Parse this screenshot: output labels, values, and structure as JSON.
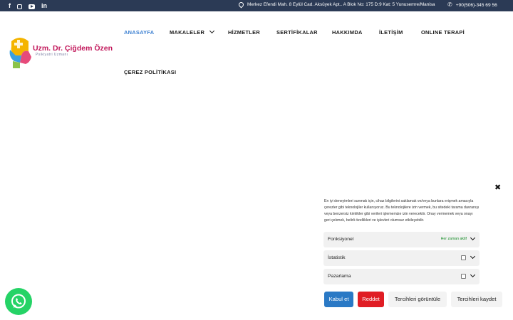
{
  "topbar": {
    "social_icons": [
      "facebook-icon",
      "instagram-icon",
      "youtube-icon",
      "linkedin-icon"
    ],
    "address": "Merkez Efendi Mah. 8 Eylül Cad. Aksüyek Apt.. A Blok No: 175 D:9 Kat: 5 Yunusemre/Manisa",
    "phone": "+90(506)-345 69 56",
    "background": "#2b3a55"
  },
  "logo": {
    "name": "Uzm. Dr. Çiğdem Özen",
    "subtitle": "Psikiyatri Uzmanı"
  },
  "nav": {
    "items": [
      {
        "label": "ANASAYFA",
        "active": true
      },
      {
        "label": "MAKALELER",
        "has_dropdown": true
      },
      {
        "label": "HİZMETLER"
      },
      {
        "label": "SERTİFİKALAR"
      },
      {
        "label": "HAKKIMDA"
      },
      {
        "label": "İLETİŞİM"
      },
      {
        "label": "ONLINE TERAPİ"
      },
      {
        "label": "ÇEREZ POLİTİKASI"
      }
    ],
    "active_color": "#3b7fd1"
  },
  "cookie": {
    "close": "✖",
    "text": "En iyi deneyimleri sunmak için, cihaz bilgilerini saklamak ve/veya bunlara erişmek amacıyla çerezler gibi teknolojiler kullanıyoruz. Bu teknolojilere izin vermek, bu sitedeki tarama davranışı veya benzersiz kimlikler gibi verileri işlememize izin verecektir. Onay vermemek veya onayı geri çekmek, belirli özellikleri ve işlevleri olumsuz etkileyebilir.",
    "categories": [
      {
        "label": "Fonksiyonel",
        "status": "Her zaman aktif"
      },
      {
        "label": "İstatistik"
      },
      {
        "label": "Pazarlama"
      }
    ],
    "buttons": {
      "accept": "Kabul et",
      "deny": "Reddet",
      "view_prefs": "Tercihleri görüntüle",
      "save_prefs": "Tercihleri kaydet"
    },
    "colors": {
      "accept": "#2a79c5",
      "deny": "#e01d24",
      "status": "#1a8f2b"
    }
  },
  "whatsapp": {
    "icon": "whatsapp-icon",
    "color": "#25d366"
  }
}
